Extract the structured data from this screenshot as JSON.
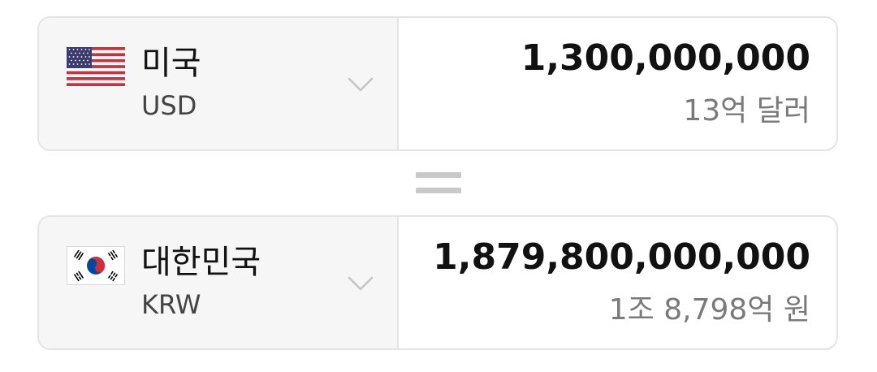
{
  "from": {
    "country": "미국",
    "code": "USD",
    "amount": "1,300,000,000",
    "amount_words": "13억 달러",
    "flag_icon": "us-flag-icon"
  },
  "to": {
    "country": "대한민국",
    "code": "KRW",
    "amount": "1,879,800,000,000",
    "amount_words": "1조 8,798억 원",
    "flag_icon": "kr-flag-icon"
  },
  "icons": {
    "dropdown": "chevron-down-icon",
    "equals": "equals-icon"
  },
  "colors": {
    "panel_bg": "#f6f6f6",
    "border": "#e4e4e4",
    "amount_text": "#111111",
    "secondary_text": "#7a7a7a",
    "equals_sign": "#c9c9c9"
  }
}
